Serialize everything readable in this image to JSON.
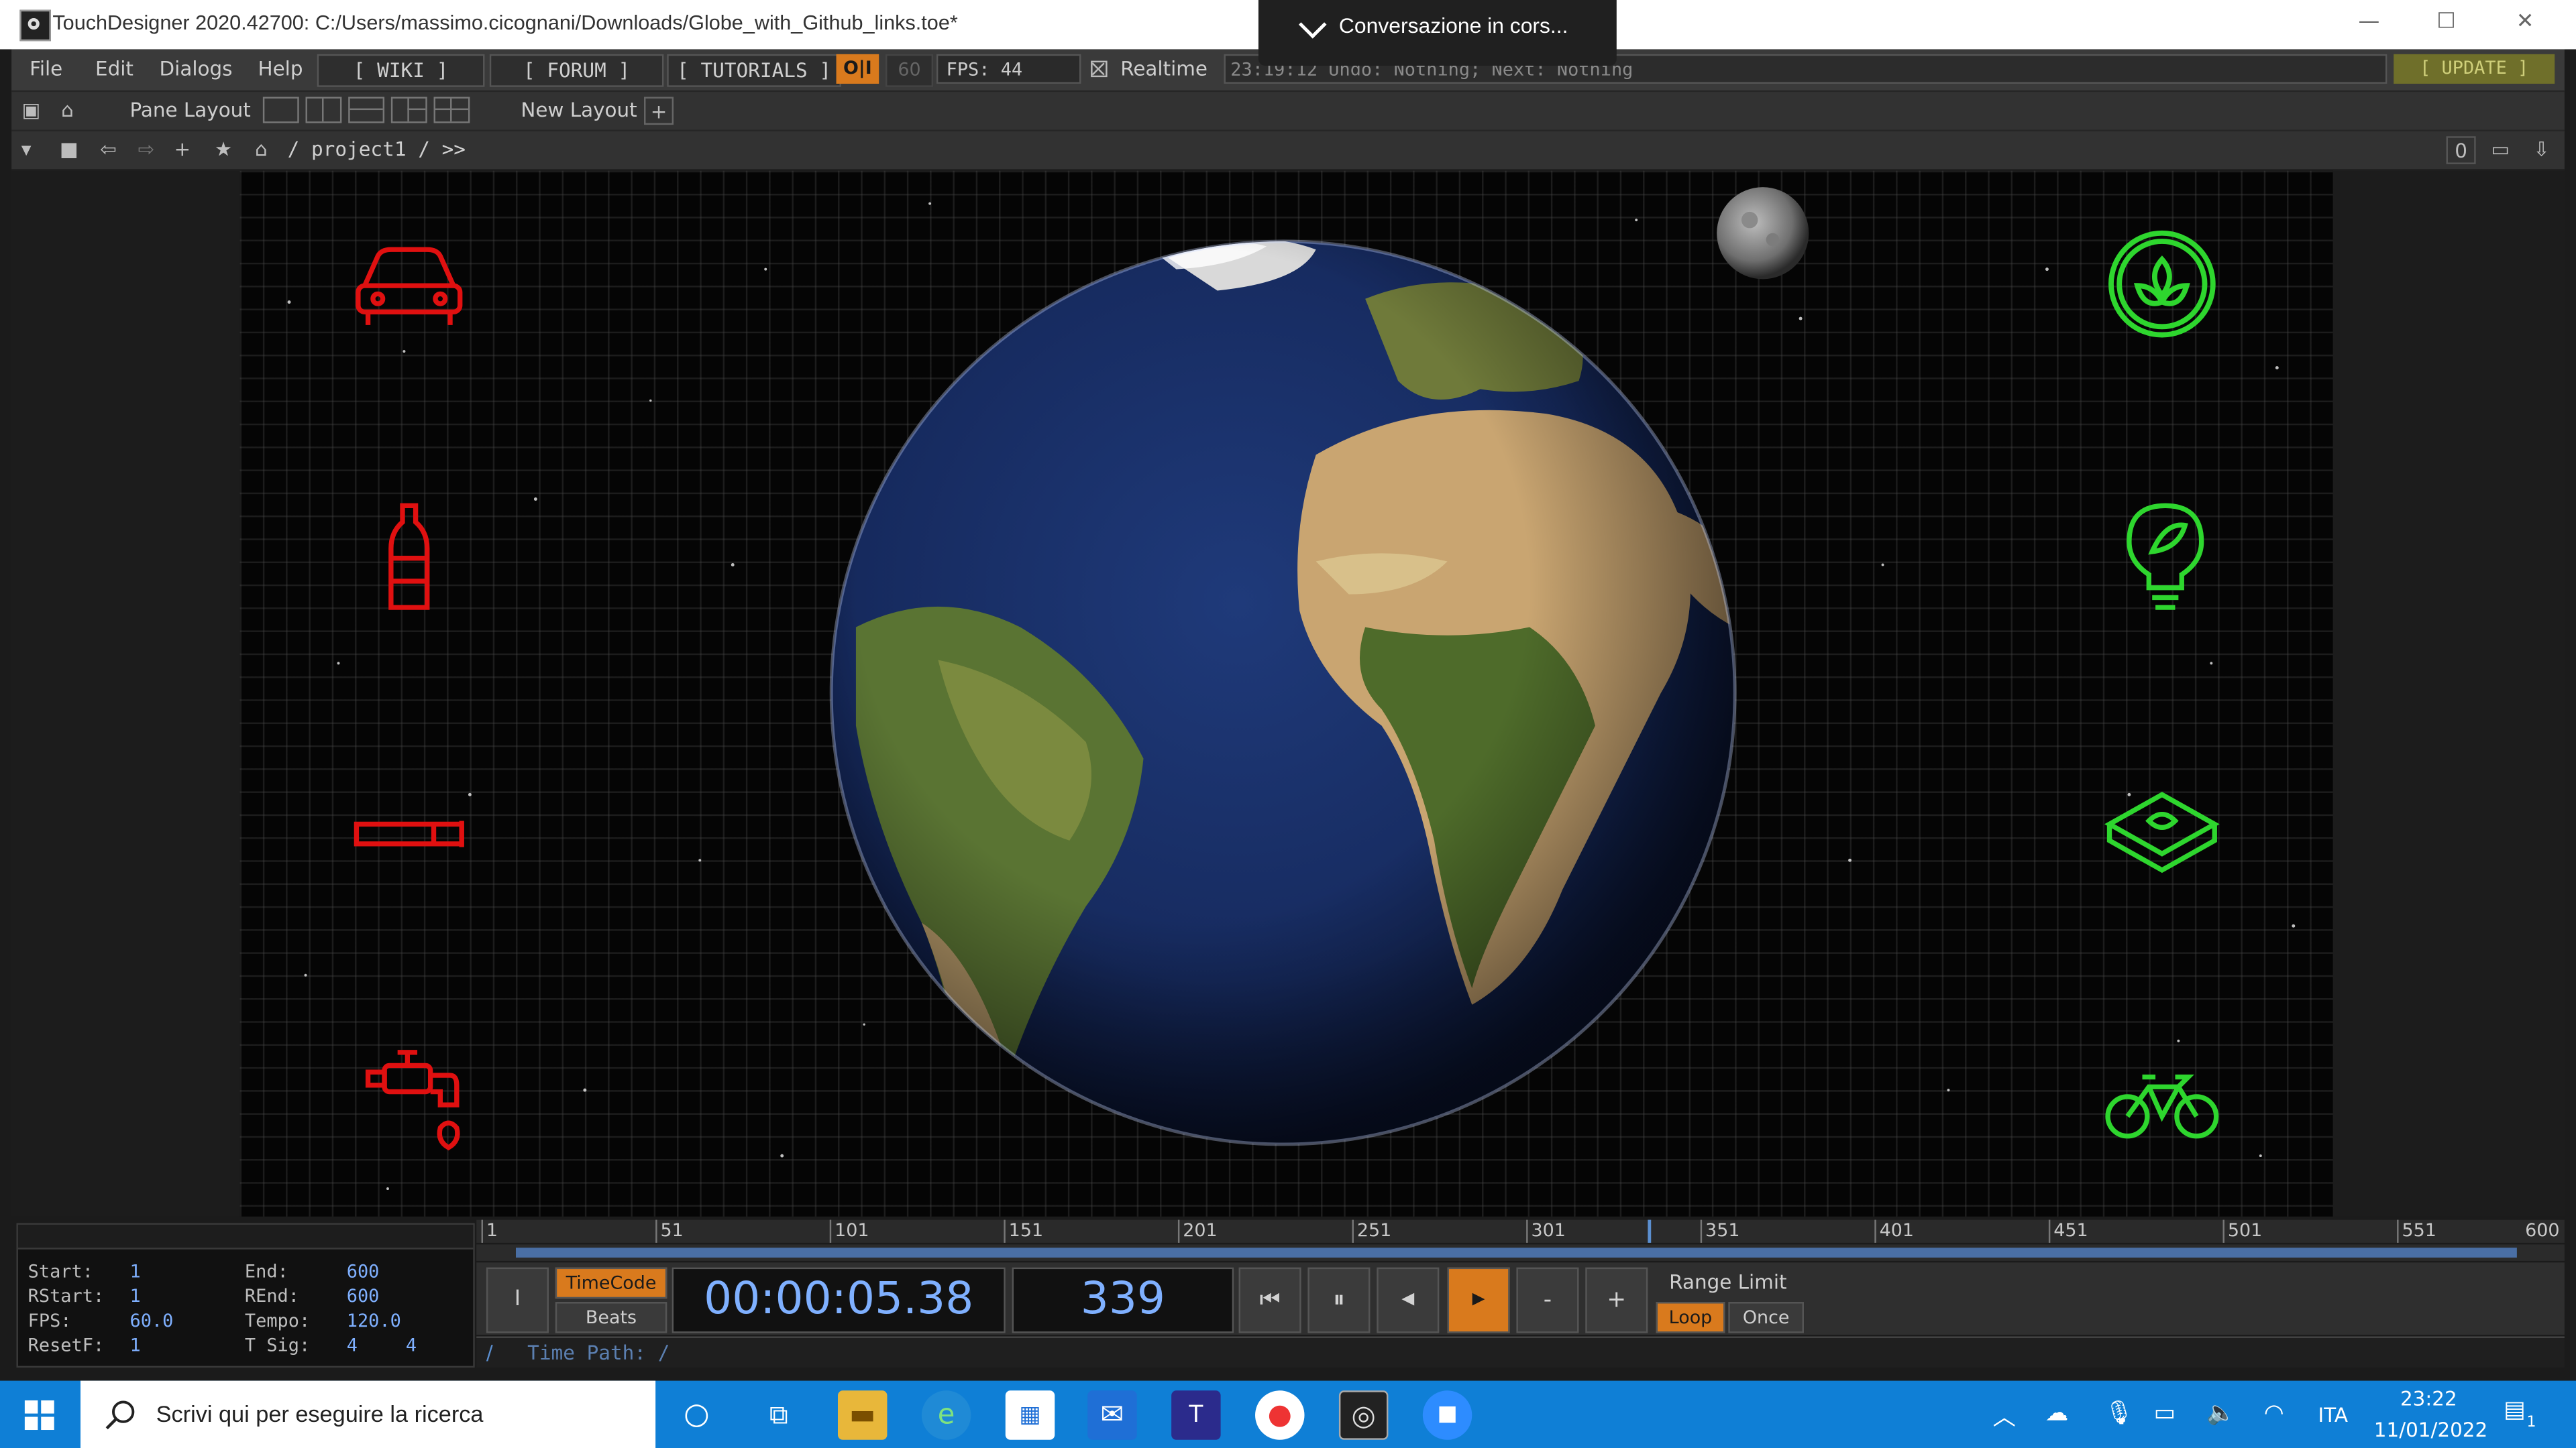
{
  "window": {
    "title": "TouchDesigner 2020.42700: C:/Users/massimo.cicognani/Downloads/Globe_with_Github_links.toe*",
    "minimize": "—",
    "maximize": "☐",
    "close": "✕"
  },
  "notification": {
    "text": "Conversazione  in  cors..."
  },
  "menu": {
    "items": [
      "File",
      "Edit",
      "Dialogs",
      "Help"
    ],
    "wiki": "[ WIKI ]",
    "forum": "[ FORUM ]",
    "tutorials": "[ TUTORIALS ]",
    "oi": "O|I",
    "fps_cap": "60",
    "fps": "FPS: 44",
    "realtime": "Realtime",
    "status": "23:19:12 Undo: Nothing; Next: Nothing",
    "update": "[ UPDATE ]"
  },
  "pane_bar": {
    "pane_layout": "Pane Layout",
    "new_layout": "New Layout",
    "add": "+"
  },
  "network_bar": {
    "path": "/  project1  /  >>",
    "right_value": "0"
  },
  "scene": {
    "left_icons": [
      "car-icon",
      "bottle-icon",
      "cigarette-icon",
      "tap-icon"
    ],
    "right_icons": [
      "plant-icon",
      "leaf-bulb-icon",
      "soap-icon",
      "bicycle-icon"
    ],
    "left_color": "#e01010",
    "right_color": "#2ed62e"
  },
  "timeline": {
    "ticks": [
      "1",
      "51",
      "101",
      "151",
      "201",
      "251",
      "301",
      "351",
      "401",
      "451",
      "501",
      "551",
      "600"
    ],
    "current_frame": 339,
    "range": [
      1,
      600
    ]
  },
  "info": {
    "start_label": "Start:",
    "start": "1",
    "end_label": "End:",
    "end": "600",
    "rstart_label": "RStart:",
    "rstart": "1",
    "rend_label": "REnd:",
    "rend": "600",
    "fps_label": "FPS:",
    "fps": "60.0",
    "tempo_label": "Tempo:",
    "tempo": "120.0",
    "resetf_label": "ResetF:",
    "resetf": "1",
    "tsig_label": "T Sig:",
    "tsig_a": "4",
    "tsig_b": "4"
  },
  "transport": {
    "timecode_label": "TimeCode",
    "beats_label": "Beats",
    "timecode": "00:00:05.38",
    "frame": "339",
    "range_limit": "Range Limit",
    "loop": "Loop",
    "once": "Once",
    "minus": "-",
    "plus": "+",
    "time_path_slash": "/",
    "time_path": "Time Path: /"
  },
  "taskbar": {
    "search_placeholder": "Scrivi qui per eseguire la ricerca",
    "language": "ITA",
    "time": "23:22",
    "date": "11/01/2022",
    "notif_count": "1"
  }
}
